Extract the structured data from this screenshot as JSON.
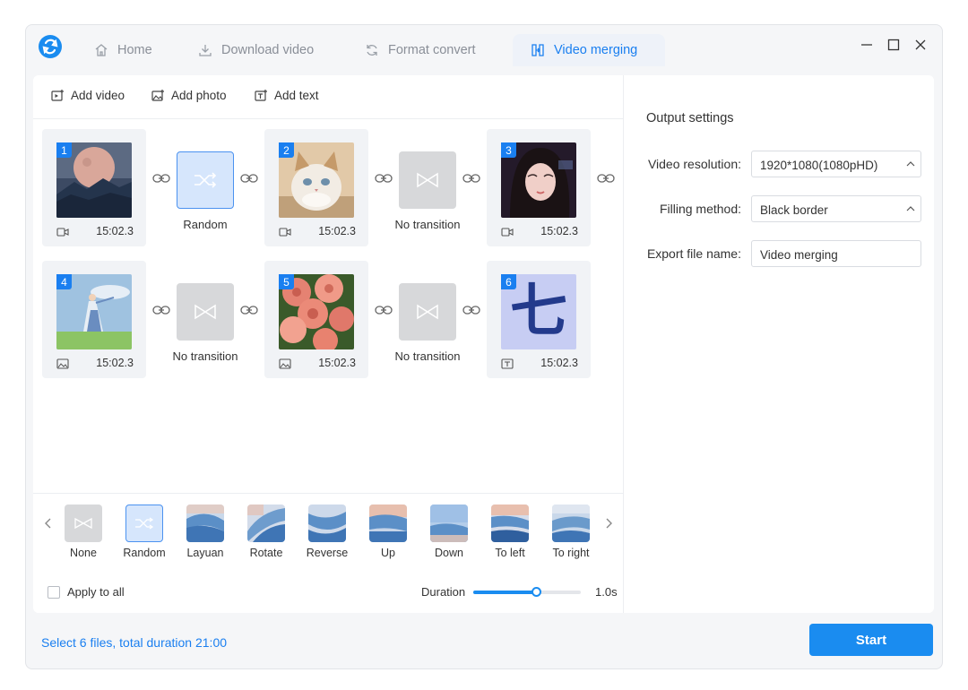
{
  "tabs": [
    {
      "label": "Home",
      "icon": "home-icon"
    },
    {
      "label": "Download video",
      "icon": "download-icon"
    },
    {
      "label": "Format convert",
      "icon": "refresh-icon"
    },
    {
      "label": "Video merging",
      "icon": "merge-icon",
      "active": true
    }
  ],
  "toolbar": {
    "add_video": "Add video",
    "add_photo": "Add photo",
    "add_text": "Add text"
  },
  "clips": [
    {
      "number": "1",
      "duration": "15:02.3",
      "type": "video-icon",
      "subject": "moon over mountains"
    },
    {
      "number": "2",
      "duration": "15:02.3",
      "type": "video-icon",
      "subject": "cat"
    },
    {
      "number": "3",
      "duration": "15:02.3",
      "type": "video-icon",
      "subject": "portrait"
    },
    {
      "number": "4",
      "duration": "15:02.3",
      "type": "image-icon",
      "subject": "girl in field"
    },
    {
      "number": "5",
      "duration": "15:02.3",
      "type": "image-icon",
      "subject": "roses"
    },
    {
      "number": "6",
      "duration": "15:02.3",
      "type": "text-icon",
      "subject": "character",
      "glyph": "七"
    }
  ],
  "transitions": [
    {
      "label": "Random",
      "kind": "random"
    },
    {
      "label": "No transition",
      "kind": "none"
    },
    {
      "label": "No transition",
      "kind": "none"
    },
    {
      "label": "No transition",
      "kind": "none"
    }
  ],
  "effects": [
    {
      "label": "None"
    },
    {
      "label": "Random"
    },
    {
      "label": "Layuan"
    },
    {
      "label": "Rotate"
    },
    {
      "label": "Reverse"
    },
    {
      "label": "Up"
    },
    {
      "label": "Down"
    },
    {
      "label": "To left"
    },
    {
      "label": "To right"
    }
  ],
  "apply_all": {
    "label": "Apply to all",
    "checked": false
  },
  "duration": {
    "label": "Duration",
    "value": "1.0s",
    "fraction": 0.58
  },
  "output": {
    "title": "Output settings",
    "resolution_label": "Video resolution:",
    "resolution_value": "1920*1080(1080pHD)",
    "filling_label": "Filling method:",
    "filling_value": "Black border",
    "filename_label": "Export file name:",
    "filename_value": "Video merging"
  },
  "status": "Select 6 files, total duration 21:00",
  "start_button": "Start",
  "colors": {
    "accent": "#1a8cf0",
    "status_text": "#1a7ff0",
    "selected_bg": "#d6e6fc"
  }
}
